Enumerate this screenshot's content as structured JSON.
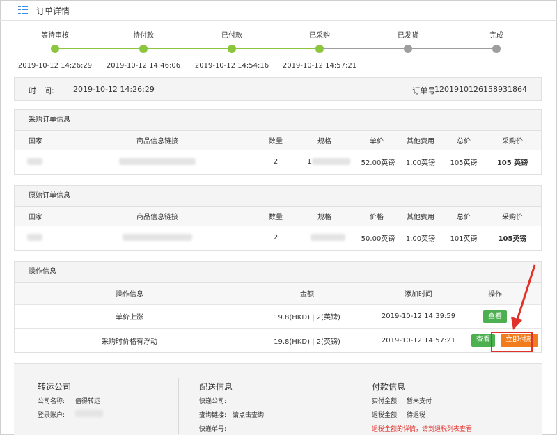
{
  "header": {
    "title": "订单详情",
    "icon": "list-icon"
  },
  "steps": [
    {
      "label": "等待审核",
      "time": "2019-10-12 14:26:29",
      "done": true
    },
    {
      "label": "待付款",
      "time": "2019-10-12 14:46:06",
      "done": true
    },
    {
      "label": "已付款",
      "time": "2019-10-12 14:54:16",
      "done": true
    },
    {
      "label": "已采购",
      "time": "2019-10-12 14:57:21",
      "done": true
    },
    {
      "label": "已发货",
      "time": "",
      "done": false
    },
    {
      "label": "完成",
      "time": "",
      "done": false
    }
  ],
  "info_bar": {
    "time_label": "时　间:",
    "time_value": "2019-10-12 14:26:29",
    "order_label": "订单号:",
    "order_value": "1201910126158931864"
  },
  "purchase_order": {
    "title": "采购订单信息",
    "columns": [
      "国家",
      "商品信息链接",
      "数量",
      "规格",
      "单价",
      "其他费用",
      "总价",
      "采购价"
    ],
    "rows": [
      {
        "country": "",
        "link": "",
        "qty": "2",
        "spec": "1",
        "price": "52.00英镑",
        "other": "1.00英镑",
        "total": "105英镑",
        "purchase": "105 英镑"
      }
    ]
  },
  "original_order": {
    "title": "原始订单信息",
    "columns": [
      "国家",
      "商品信息链接",
      "数量",
      "规格",
      "价格",
      "其他费用",
      "总价",
      "采购价"
    ],
    "rows": [
      {
        "country": "",
        "link": "",
        "qty": "2",
        "spec": "",
        "price": "50.00英镑",
        "other": "1.00英镑",
        "total": "101英镑",
        "purchase": "105英镑"
      }
    ]
  },
  "operation_info": {
    "title": "操作信息",
    "columns": [
      "操作信息",
      "金额",
      "添加时间",
      "操作"
    ],
    "rows": [
      {
        "info": "单价上涨",
        "amount": "19.8(HKD) | 2(英镑)",
        "time": "2019-10-12 14:39:59",
        "view_label": "查看"
      },
      {
        "info": "采购时价格有浮动",
        "amount": "19.8(HKD) | 2(英镑)",
        "time": "2019-10-12 14:57:21",
        "view_label": "查看",
        "pay_label": "立即付款"
      }
    ]
  },
  "bottom": {
    "forwarder": {
      "title": "转运公司",
      "company_label": "公司名称:",
      "company_value": "值得转运",
      "account_label": "登录账户:"
    },
    "delivery": {
      "title": "配送信息",
      "courier_label": "快递公司:",
      "query_label": "查询链接:",
      "query_value": "请点击查询",
      "tracking_label": "快递单号:"
    },
    "payment": {
      "title": "付款信息",
      "paid_label": "实付金额:",
      "paid_value": "暂未支付",
      "refund_label": "退税金额:",
      "refund_value": "待退税",
      "refund_note": "退税金额的详情，请到退税列表查看"
    }
  },
  "colors": {
    "step_done": "#8cc63f",
    "step_pending": "#9e9e9e",
    "view_button": "#4caf50",
    "pay_button": "#f07c1e",
    "highlight": "#e0312b"
  }
}
